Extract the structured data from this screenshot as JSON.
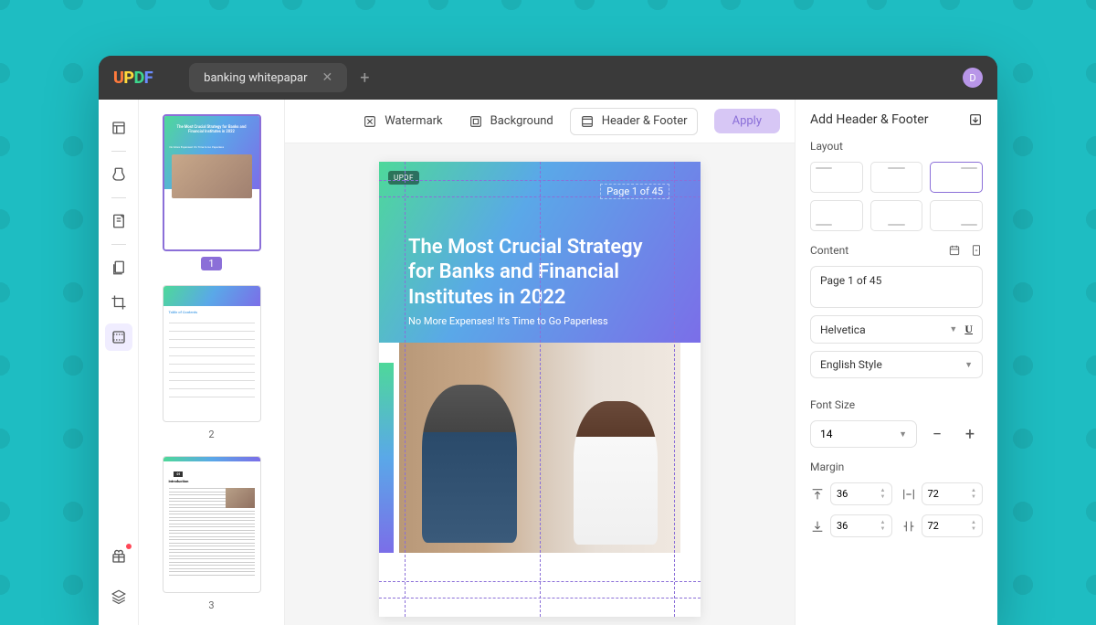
{
  "titlebar": {
    "logo": {
      "u": "U",
      "p": "P",
      "d": "D",
      "f": "F"
    },
    "tab": "banking whitepapar",
    "avatar": "D"
  },
  "toolbar": {
    "watermark": "Watermark",
    "background": "Background",
    "headerfooter": "Header & Footer",
    "apply": "Apply"
  },
  "thumbs": {
    "p1": {
      "num": "1",
      "title": "The Most Crucial Strategy for Banks and Financial Institutes in 2022",
      "sub": "No More Expenses! It's Time to Go Paperless"
    },
    "p2": {
      "num": "2",
      "toc": "Table of Contents"
    },
    "p3": {
      "num": "3",
      "intro_n": "01",
      "intro": "Introduction"
    }
  },
  "page": {
    "logo": "UPDF",
    "header": "Page 1 of 45",
    "title": "The Most Crucial Strategy for Banks and Financial Institutes in 2022",
    "sub": "No More Expenses! It's Time to Go Paperless"
  },
  "panel": {
    "title": "Add Header & Footer",
    "layout_label": "Layout",
    "content_label": "Content",
    "content_value": "Page 1 of 45",
    "font": "Helvetica",
    "style": "English Style",
    "fontsize_label": "Font Size",
    "fontsize": "14",
    "margin_label": "Margin",
    "margins": {
      "top": "36",
      "outside": "72",
      "bottom": "36",
      "inside": "72"
    }
  }
}
